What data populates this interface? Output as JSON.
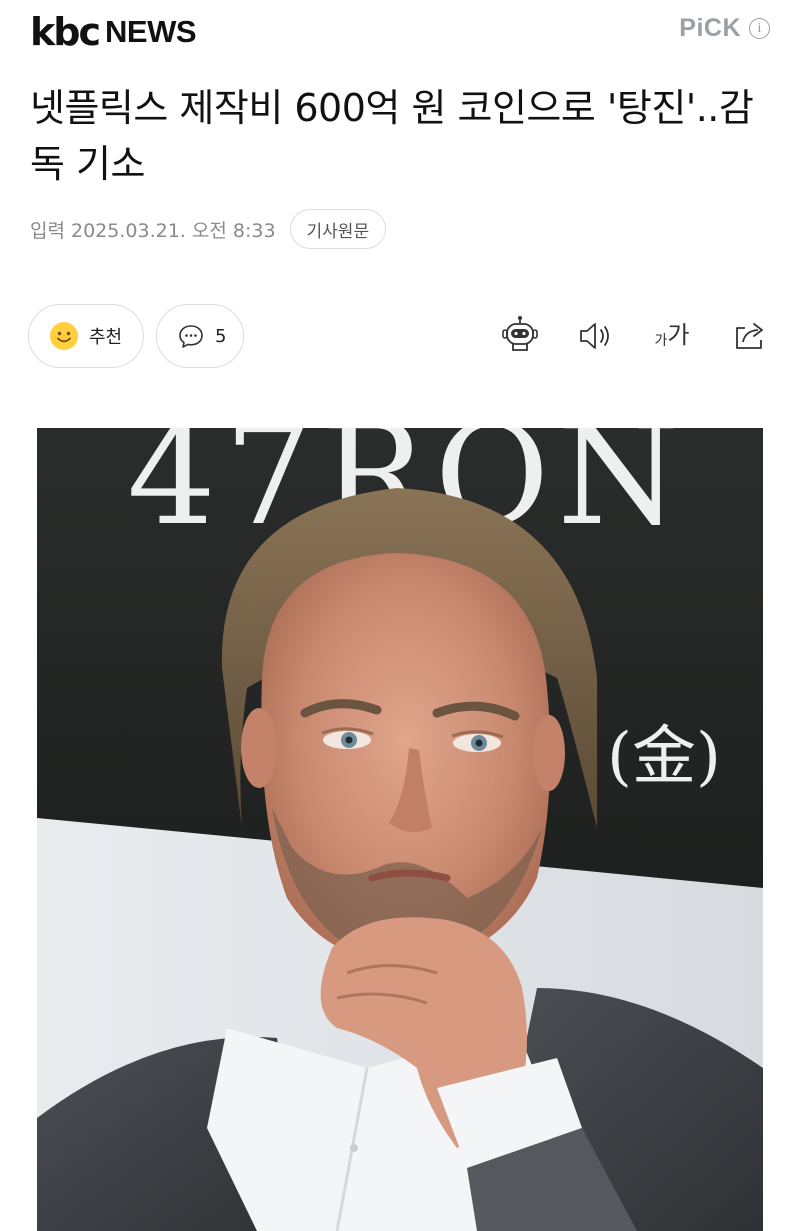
{
  "header": {
    "logo_primary": "kbc",
    "logo_secondary": "NEWS",
    "pick_label": "PiCK",
    "pick_info": "i"
  },
  "article": {
    "title": "넷플릭스 제작비 600억 원 코인으로 '탕진'..감독 기소",
    "published": "입력 2025.03.21. 오전 8:33",
    "original_link_label": "기사원문"
  },
  "actions": {
    "recommend_label": "추천",
    "comment_count": "5"
  },
  "tools": {
    "ai_summary_icon": "robot-icon",
    "tts_icon": "speaker-icon",
    "font_size_small": "가",
    "font_size_large": "가",
    "share_icon": "share-icon"
  },
  "photo": {
    "backdrop_text_top": "47RON",
    "backdrop_text_mid": "(金)"
  },
  "colors": {
    "text": "#111111",
    "muted": "#8a8a8a",
    "border": "#dcdcdc",
    "emoji_yellow": "#ffcf3d",
    "backdrop_dark": "#1f2220"
  }
}
